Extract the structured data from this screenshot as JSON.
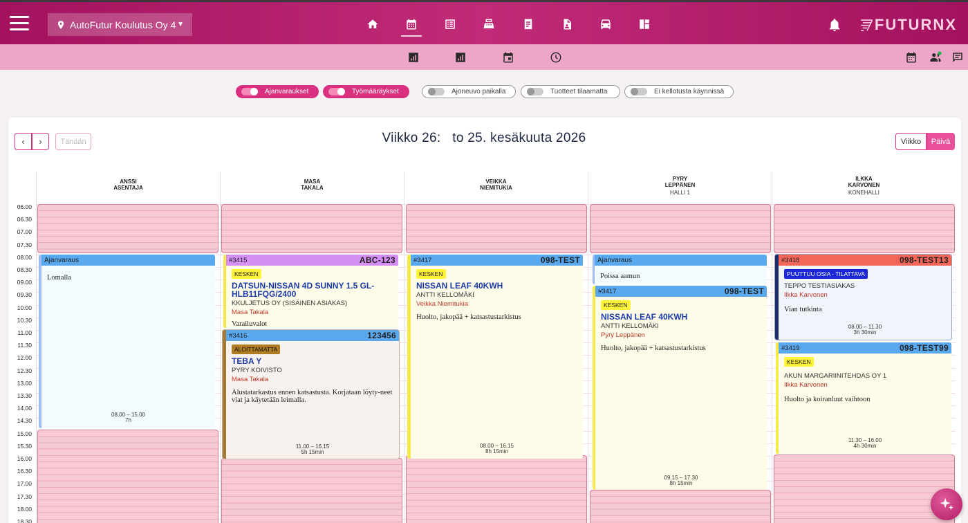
{
  "company": "AutoFutur Koulutus Oy 4",
  "logo_text": "FUTURNX",
  "filters": [
    {
      "label": "Ajanvaraukset",
      "on": true
    },
    {
      "label": "Työmääräykset",
      "on": true
    },
    {
      "label": "Ajoneuvo paikalla",
      "on": false
    },
    {
      "label": "Tuotteet tilaamatta",
      "on": false
    },
    {
      "label": "Ei kellotusta käynnissä",
      "on": false
    }
  ],
  "toolbar": {
    "prev": "‹",
    "next": "›",
    "today": "Tänään",
    "week": "Viikko",
    "day": "Päivä"
  },
  "title": "Viikko 26:   to 25. kesäkuuta 2026",
  "columns": [
    {
      "name1": "ANSSI",
      "name2": "ASENTAJA",
      "sub": ""
    },
    {
      "name1": "MASA",
      "name2": "TAKALA",
      "sub": ""
    },
    {
      "name1": "VEIKKA",
      "name2": "NIEMITUKIA",
      "sub": ""
    },
    {
      "name1": "PYRY",
      "name2": "LEPPÄNEN",
      "sub": "HALLI 1"
    },
    {
      "name1": "ILKKA",
      "name2": "KARVONEN",
      "sub": "KONEHALLI"
    }
  ],
  "times": [
    "06.00",
    "06.30",
    "07.00",
    "07.30",
    "08.00",
    "08.30",
    "09.00",
    "09.30",
    "10.00",
    "10.30",
    "11.00",
    "11.30",
    "12.00",
    "12.30",
    "13.00",
    "13.30",
    "14.00",
    "14.30",
    "15.00",
    "15.30",
    "16.00",
    "16.30",
    "17.00",
    "17.30",
    "18.00",
    "18.30"
  ],
  "events": {
    "e1": {
      "head": "Ajanvaraus",
      "desc": "Lomalla",
      "time": "08.00 – 15.00",
      "dur": "7h"
    },
    "e2": {
      "num": "#3415",
      "reg": "ABC-123",
      "badge": "KESKEN",
      "title": "DATSUN-NISSAN 4D SUNNY 1.5 GL-HLB11FQG/2400",
      "cust": "KKULJETUS OY (SISÄINEN ASIAKAS)",
      "mech": "Masa Takala",
      "desc": "Varailuvalot"
    },
    "e3": {
      "num": "#3416",
      "reg": "123456",
      "badge": "ALOITTAMATTA",
      "title": "TEBA Y",
      "cust": "PYRY KOIVISTO",
      "mech": "Masa Takala",
      "desc": "Alustatarkastus ennen katsastusta. Korjataan löyty-neet viat ja käytetään leimalla.",
      "time": "11.00 – 16.15",
      "dur": "5h 15min"
    },
    "e4": {
      "num": "#3417",
      "reg": "098-TEST",
      "badge": "KESKEN",
      "title": "NISSAN LEAF 40KWH",
      "cust": "ANTTI KELLOMÄKI",
      "mech": "Veikka Niemitukia",
      "desc": "Huolto, jakopää + katsastustarkistus",
      "time": "08.00 – 16.15",
      "dur": "8h 15min"
    },
    "e5": {
      "head": "Ajanvaraus",
      "desc": "Poissa aamun"
    },
    "e6": {
      "num": "#3417",
      "reg": "098-TEST",
      "badge": "KESKEN",
      "title": "NISSAN LEAF 40KWH",
      "cust": "ANTTI KELLOMÄKI",
      "mech": "Pyry Leppänen",
      "desc": "Huolto, jakopää + katsastustarkistus",
      "time": "09.15 – 17.30",
      "dur": "8h 15min"
    },
    "e7": {
      "num": "#3418",
      "reg": "098-TEST13",
      "badge": "PUUTTUU OSIA - TILATTAVA",
      "cust": "TEPPO TESTIASIAKAS",
      "mech": "Ilkka Karvonen",
      "desc": "Vian tutkinta",
      "time": "08.00 – 11.30",
      "dur": "3h 30min"
    },
    "e8": {
      "num": "#3419",
      "reg": "098-TEST99",
      "badge": "KESKEN",
      "cust": "AKUN MARGARIINITEHDAS OY 1",
      "mech": "Ilkka Karvonen",
      "desc": "Huolto ja koiranluut vaihtoon",
      "time": "11.30 – 16.00",
      "dur": "4h 30min"
    }
  },
  "colors": {
    "brand": "#c02b78",
    "accent": "#e8519a",
    "status_kesken": "#fff33a",
    "status_aloittamatta": "#b07c22",
    "status_puuttuu": "#1a27d9"
  },
  "icons": [
    "menu-icon",
    "location-pin-icon",
    "home-icon",
    "calendar-icon",
    "list-icon",
    "cash-register-icon",
    "receipt-icon",
    "document-icon",
    "car-icon",
    "dashboard-icon",
    "bell-icon",
    "chart-icon",
    "clock-icon",
    "people-icon",
    "chat-icon",
    "sparkle-icon"
  ]
}
